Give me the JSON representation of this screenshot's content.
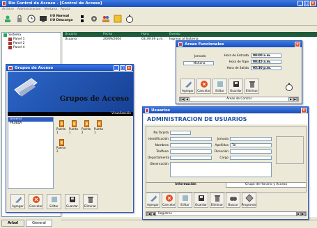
{
  "app": {
    "title": "Bio Control de Acceso - [Control de Acceso]",
    "menu": [
      "Archivo",
      "Administracion",
      "Ventana",
      "Ayuda"
    ],
    "toolbar": {
      "io_label_1": "I/O Normal",
      "io_label_2": "I/O Descarga"
    }
  },
  "tree": {
    "root": "Sistema",
    "items": [
      "Panel 1",
      "Panel 2",
      "Panel 4"
    ]
  },
  "grid": {
    "columns": [
      "Usuario",
      "Fecha",
      "Hora",
      "Evento"
    ],
    "rows": [
      {
        "usuario": "Usuario",
        "fecha": "20/09/2004",
        "hora": "03:39:49 p.m.",
        "evento": "Ingreso al Sistema"
      }
    ]
  },
  "bottom_tabs": [
    "Arbol",
    "General"
  ],
  "areas": {
    "title": "Areas Funcionales",
    "jornada_label": "Jornada",
    "jornada_value": "Mañana",
    "entrada_label": "Hora de Entrada",
    "entrada_value": "08:00 a.m.",
    "tope_label": "Hora de Tope",
    "tope_value": "08:45 a.m.",
    "salida_label": "Hora de Salida",
    "salida_value": "05:30 p.m.",
    "buttons": [
      "Agregar",
      "Cancelar",
      "Editar",
      "Guardar",
      "Eliminar"
    ],
    "nav_text": "Áreas de Control"
  },
  "grupos": {
    "title": "Grupos de Acceso",
    "banner": "Grupos de Acceso",
    "visualizacion": "Visualización",
    "list": [
      "General",
      "PRUEBA"
    ],
    "doors": [
      "Puerta 1",
      "Puerta 1",
      "Puerta 2",
      "Puerta 1",
      "Puerta 2"
    ],
    "buttons": [
      "Agregar",
      "Cancelar",
      "Editar",
      "Guardar",
      "Eliminar"
    ]
  },
  "usuarios": {
    "title": "Usuarios",
    "heading": "ADMINISTRACION DE USUARIOS",
    "labels": {
      "tarjeta": "No.Tarjeta",
      "identificacion": "Identificación",
      "nombres": "Nombres",
      "telefono": "Teléfono",
      "departamento": "Departamento",
      "observacion": "Observación",
      "jornada": "Jornada",
      "apellidos": "Apellidos",
      "direccion": "Dirección",
      "cargo": "Cargo"
    },
    "apellidos_value": "Tal",
    "tabs": [
      "Información",
      "Grupo de Horario y Acceso"
    ],
    "buttons": [
      "Agregar",
      "Cancelar",
      "Editar",
      "Guardar",
      "Eliminar",
      "Buscar",
      "Programar"
    ],
    "nav_text": "Registros"
  },
  "colors": {
    "title_blue": "#1a4fc0",
    "header_green": "#1f5a3a",
    "usuarios_heading": "#1d4fa0"
  }
}
